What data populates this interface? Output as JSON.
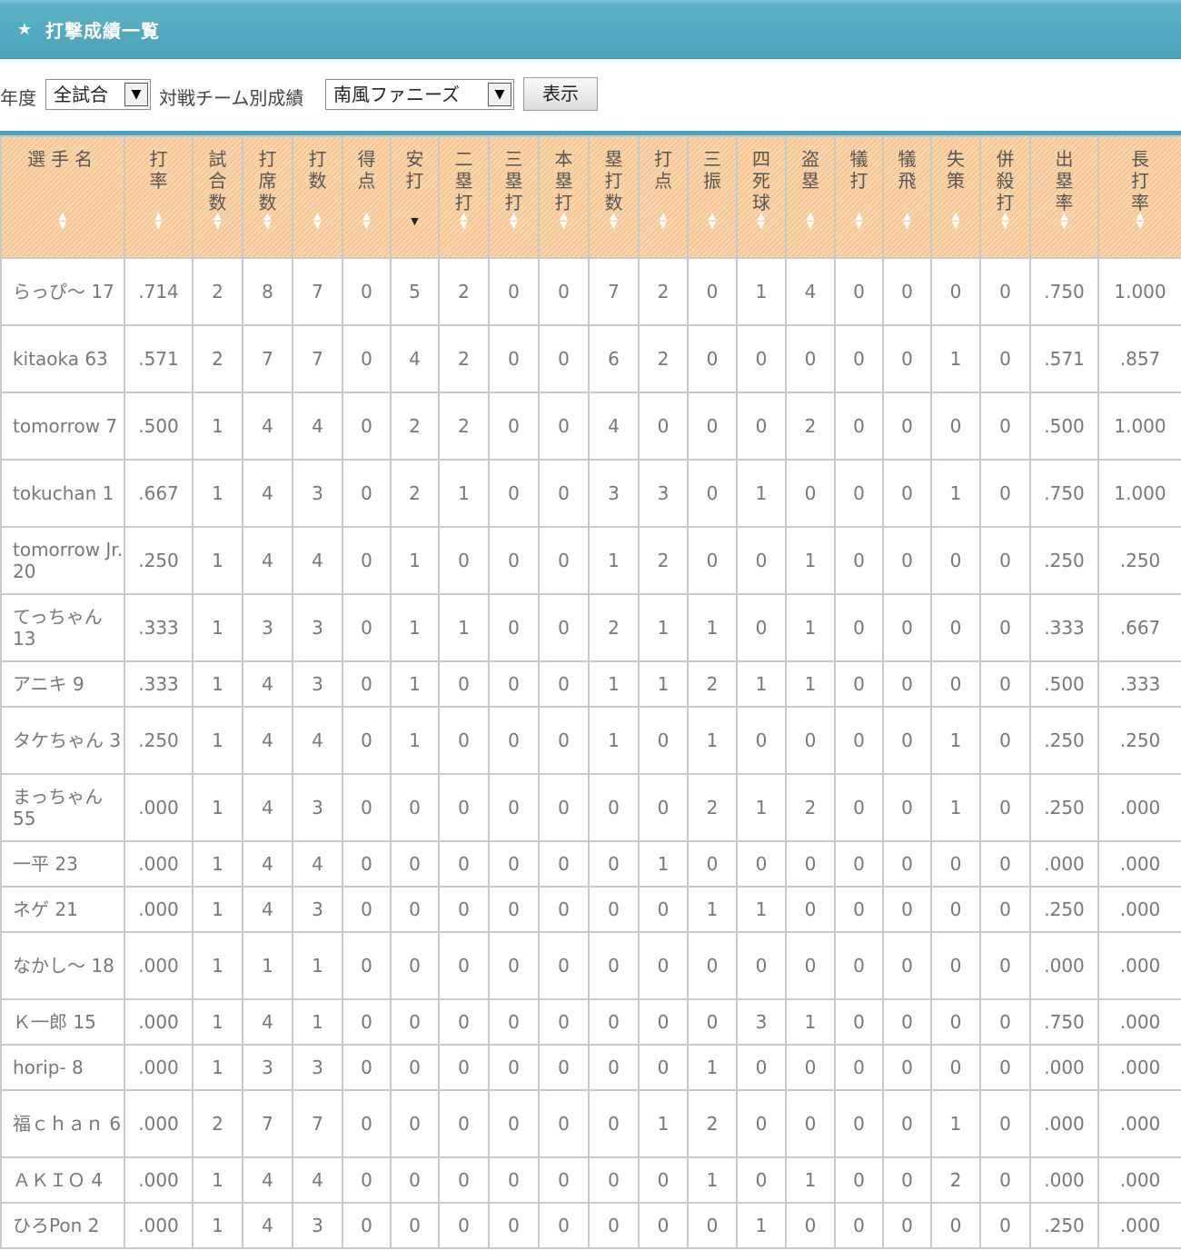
{
  "header": {
    "title": "打撃成績一覧",
    "icon": "star-icon"
  },
  "filters": {
    "year_label": "年度",
    "year_value": "全試合",
    "team_label": "対戦チーム別成績",
    "team_value": "南風ファニーズ",
    "submit_label": "表示"
  },
  "table": {
    "columns": [
      "選手名",
      "打率",
      "試合数",
      "打席数",
      "打数",
      "得点",
      "安打",
      "二塁打",
      "三塁打",
      "本塁打",
      "塁打数",
      "打点",
      "三振",
      "四死球",
      "盗塁",
      "犠打",
      "犠飛",
      "失策",
      "併殺打",
      "出塁率",
      "長打率"
    ],
    "sorted_column": "安打",
    "rows": [
      [
        "らっぴ～ 17",
        ".714",
        "2",
        "8",
        "7",
        "0",
        "5",
        "2",
        "0",
        "0",
        "7",
        "2",
        "0",
        "1",
        "4",
        "0",
        "0",
        "0",
        "0",
        ".750",
        "1.000"
      ],
      [
        "kitaoka 63",
        ".571",
        "2",
        "7",
        "7",
        "0",
        "4",
        "2",
        "0",
        "0",
        "6",
        "2",
        "0",
        "0",
        "0",
        "0",
        "0",
        "1",
        "0",
        ".571",
        ".857"
      ],
      [
        "tomorrow 7",
        ".500",
        "1",
        "4",
        "4",
        "0",
        "2",
        "2",
        "0",
        "0",
        "4",
        "0",
        "0",
        "0",
        "2",
        "0",
        "0",
        "0",
        "0",
        ".500",
        "1.000"
      ],
      [
        "tokuchan 1",
        ".667",
        "1",
        "4",
        "3",
        "0",
        "2",
        "1",
        "0",
        "0",
        "3",
        "3",
        "0",
        "1",
        "0",
        "0",
        "0",
        "1",
        "0",
        ".750",
        "1.000"
      ],
      [
        "tomorrow Jr. 20",
        ".250",
        "1",
        "4",
        "4",
        "0",
        "1",
        "0",
        "0",
        "0",
        "1",
        "2",
        "0",
        "0",
        "1",
        "0",
        "0",
        "0",
        "0",
        ".250",
        ".250"
      ],
      [
        "てっちゃん 13",
        ".333",
        "1",
        "3",
        "3",
        "0",
        "1",
        "1",
        "0",
        "0",
        "2",
        "1",
        "1",
        "0",
        "1",
        "0",
        "0",
        "0",
        "0",
        ".333",
        ".667"
      ],
      [
        "アニキ 9",
        ".333",
        "1",
        "4",
        "3",
        "0",
        "1",
        "0",
        "0",
        "0",
        "1",
        "1",
        "2",
        "1",
        "1",
        "0",
        "0",
        "0",
        "0",
        ".500",
        ".333"
      ],
      [
        "タケちゃん 3",
        ".250",
        "1",
        "4",
        "4",
        "0",
        "1",
        "0",
        "0",
        "0",
        "1",
        "0",
        "1",
        "0",
        "0",
        "0",
        "0",
        "1",
        "0",
        ".250",
        ".250"
      ],
      [
        "まっちゃん 55",
        ".000",
        "1",
        "4",
        "3",
        "0",
        "0",
        "0",
        "0",
        "0",
        "0",
        "0",
        "2",
        "1",
        "2",
        "0",
        "0",
        "1",
        "0",
        ".250",
        ".000"
      ],
      [
        "一平 23",
        ".000",
        "1",
        "4",
        "4",
        "0",
        "0",
        "0",
        "0",
        "0",
        "0",
        "1",
        "0",
        "0",
        "0",
        "0",
        "0",
        "0",
        "0",
        ".000",
        ".000"
      ],
      [
        "ネゲ 21",
        ".000",
        "1",
        "4",
        "3",
        "0",
        "0",
        "0",
        "0",
        "0",
        "0",
        "0",
        "1",
        "1",
        "0",
        "0",
        "0",
        "0",
        "0",
        ".250",
        ".000"
      ],
      [
        "なかし～ 18",
        ".000",
        "1",
        "1",
        "1",
        "0",
        "0",
        "0",
        "0",
        "0",
        "0",
        "0",
        "0",
        "0",
        "0",
        "0",
        "0",
        "0",
        "0",
        ".000",
        ".000"
      ],
      [
        "Ｋ一郎 15",
        ".000",
        "1",
        "4",
        "1",
        "0",
        "0",
        "0",
        "0",
        "0",
        "0",
        "0",
        "0",
        "3",
        "1",
        "0",
        "0",
        "0",
        "0",
        ".750",
        ".000"
      ],
      [
        "horip- 8",
        ".000",
        "1",
        "3",
        "3",
        "0",
        "0",
        "0",
        "0",
        "0",
        "0",
        "0",
        "1",
        "0",
        "0",
        "0",
        "0",
        "0",
        "0",
        ".000",
        ".000"
      ],
      [
        "福ｃｈａｎ 6",
        ".000",
        "2",
        "7",
        "7",
        "0",
        "0",
        "0",
        "0",
        "0",
        "0",
        "1",
        "2",
        "0",
        "0",
        "0",
        "0",
        "1",
        "0",
        ".000",
        ".000"
      ],
      [
        "ＡＫＩＯ 4",
        ".000",
        "1",
        "4",
        "4",
        "0",
        "0",
        "0",
        "0",
        "0",
        "0",
        "0",
        "1",
        "0",
        "1",
        "0",
        "0",
        "2",
        "0",
        ".000",
        ".000"
      ],
      [
        "ひろPon 2",
        ".000",
        "1",
        "4",
        "3",
        "0",
        "0",
        "0",
        "0",
        "0",
        "0",
        "0",
        "0",
        "1",
        "0",
        "0",
        "0",
        "0",
        "0",
        ".250",
        ".000"
      ]
    ]
  }
}
